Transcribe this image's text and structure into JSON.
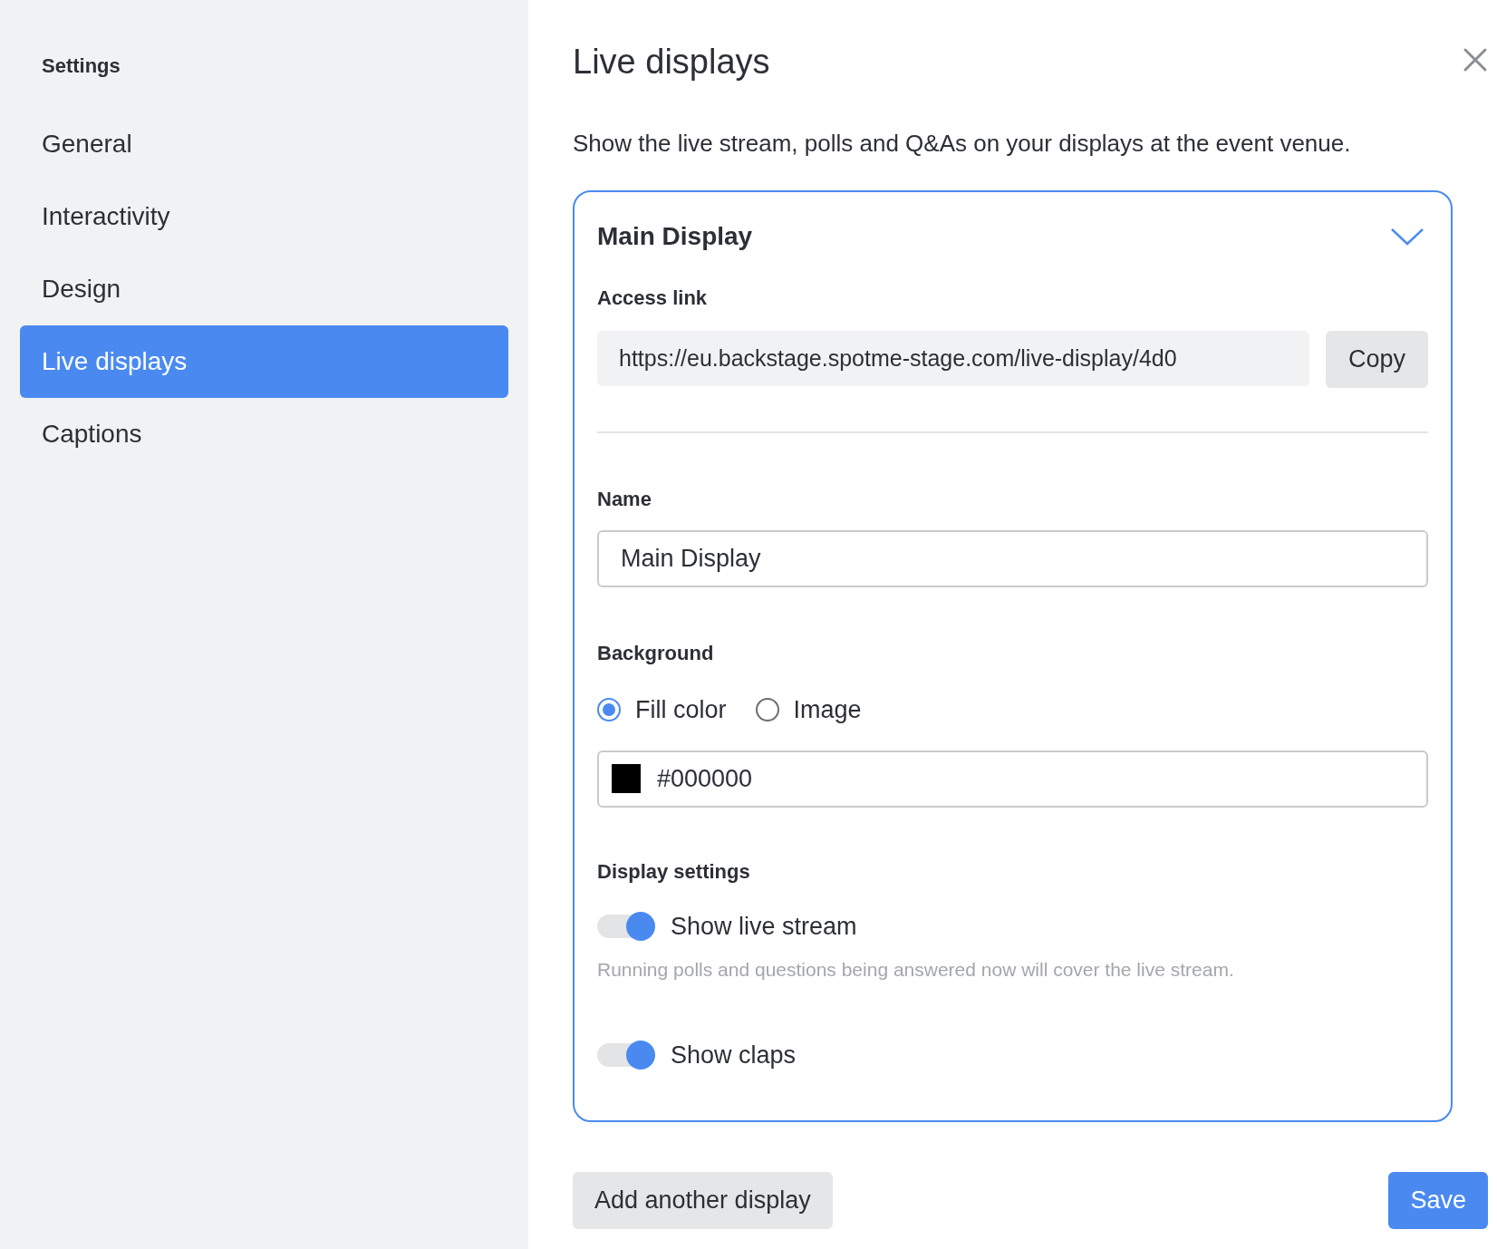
{
  "sidebar": {
    "title": "Settings",
    "items": [
      {
        "label": "General",
        "selected": false
      },
      {
        "label": "Interactivity",
        "selected": false
      },
      {
        "label": "Design",
        "selected": false
      },
      {
        "label": "Live displays",
        "selected": true
      },
      {
        "label": "Captions",
        "selected": false
      }
    ]
  },
  "panel": {
    "title": "Live displays",
    "description": "Show the live stream, polls and Q&As on your displays at the event venue.",
    "displays": [
      {
        "title": "Main Display",
        "expanded": true,
        "access_link": {
          "label": "Access link",
          "value": "https://eu.backstage.spotme-stage.com/live-display/4d0",
          "button": "Copy"
        },
        "name": {
          "label": "Name",
          "value": "Main Display"
        },
        "background": {
          "label": "Background",
          "options": [
            {
              "label": "Fill color",
              "selected": true
            },
            {
              "label": "Image",
              "selected": false
            }
          ],
          "color_value": "#000000"
        },
        "display_settings": {
          "label": "Display settings",
          "toggles": [
            {
              "label": "Show live stream",
              "on": true,
              "hint": "Running polls and questions being answered now will cover the live stream."
            },
            {
              "label": "Show claps",
              "on": true
            }
          ]
        }
      }
    ],
    "add_button": "Add another display",
    "save_button": "Save"
  }
}
